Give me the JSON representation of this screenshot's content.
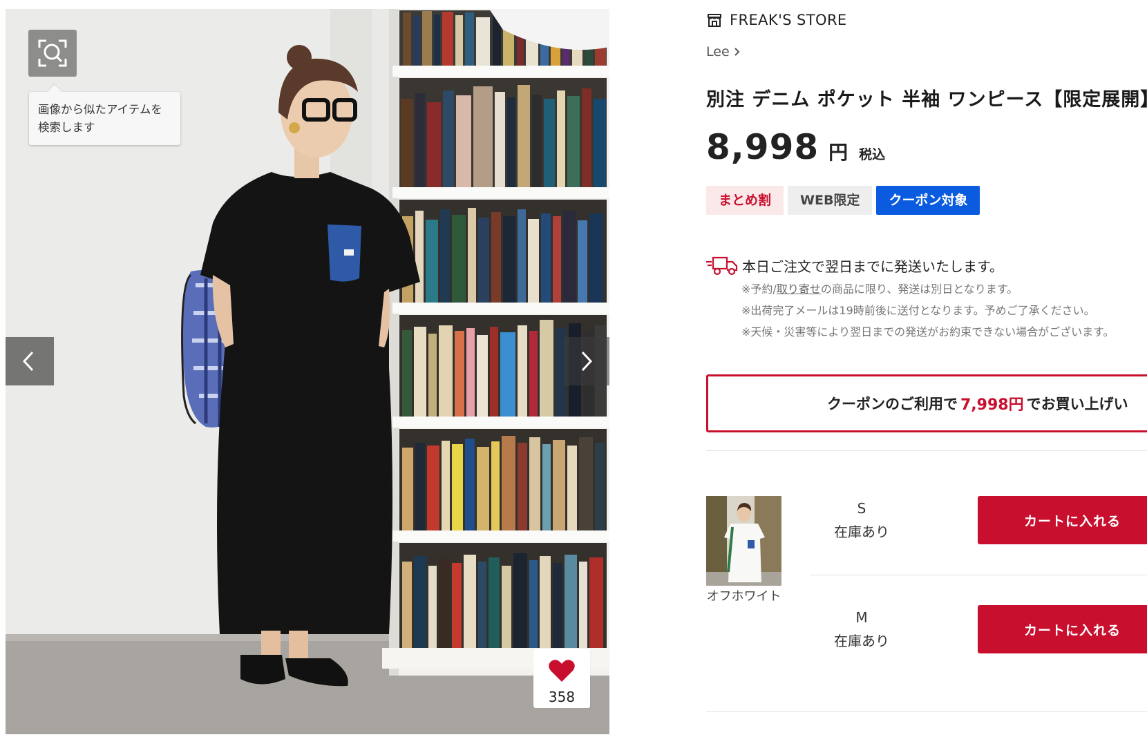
{
  "gallery": {
    "image_search_tooltip": [
      "画像から似たアイテムを",
      "検索します"
    ],
    "favorite_count": "358"
  },
  "product": {
    "shop_name": "FREAK'S STORE",
    "brand": "Lee",
    "title": "別注 デニム ポケット 半袖 ワンピース【限定展開】",
    "price": "8,998",
    "price_unit": "円",
    "tax_label": "税込",
    "tags": [
      "まとめ割",
      "WEB限定",
      "クーポン対象"
    ]
  },
  "shipping": {
    "headline": "本日ご注文で翌日までに発送いたします。",
    "note1_prefix": "※予約/",
    "note1_link": "取り寄せ",
    "note1_suffix": "の商品に限り、発送は別日となります。",
    "note2": "※出荷完了メールは19時前後に送付となります。予めご了承ください。",
    "note3": "※天候・災害等により翌日までの発送がお約束できない場合がございます。"
  },
  "coupon": {
    "prefix": "クーポンのご利用で",
    "amount": "7,998円",
    "suffix": "でお買い上げい"
  },
  "variants": {
    "color_name": "オフホワイト",
    "sizes": [
      {
        "size": "S",
        "stock": "在庫あり",
        "button": "カートに入れる"
      },
      {
        "size": "M",
        "stock": "在庫あり",
        "button": "カートに入れる"
      }
    ]
  },
  "colors": {
    "accent_red": "#c8102e",
    "coupon_blue": "#0a5be0"
  }
}
